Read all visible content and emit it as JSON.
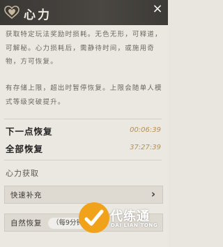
{
  "header": {
    "title": "心力",
    "close_label": "×"
  },
  "description": {
    "para1": "获取特定玩法奖励时损耗。无色无形，可释道，可解秘。心力损耗后，需静待时间，或施用奇物，方可恢复。",
    "para2": "有存储上限，超出时暂停恢复。上限会随单人模式等级突破提升。"
  },
  "recovery": [
    {
      "label": "下一点恢复",
      "time": "00:06:39"
    },
    {
      "label": "全部恢复",
      "time": "37:27:39"
    }
  ],
  "acquire": {
    "title": "心力获取",
    "buttons": [
      {
        "label": "快速补充"
      },
      {
        "label": "自然恢复",
        "hint": "（每9分钟"
      }
    ]
  },
  "watermark": {
    "name": "代练通",
    "sub": "DAI LIAN TONG"
  },
  "colors": {
    "header_bg": "#3a3835",
    "accent": "#b88f4a",
    "watermark": "#f0a21a"
  }
}
